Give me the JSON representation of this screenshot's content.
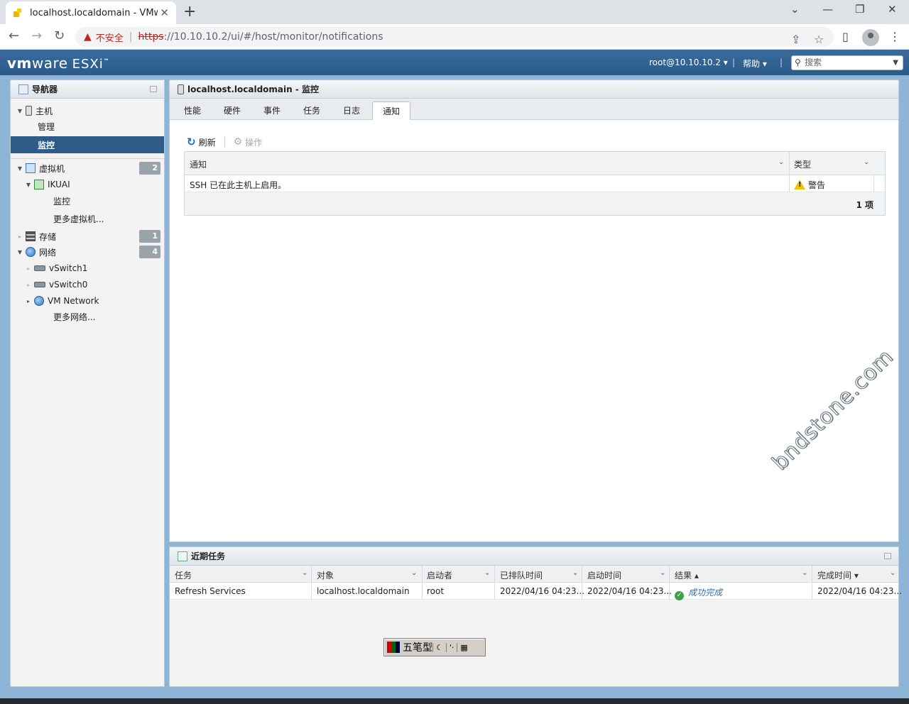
{
  "browser": {
    "tab_title": "localhost.localdomain - VMware ESXi",
    "new_tab": "+",
    "insecure_label": "不安全",
    "url_scheme": "https",
    "url_rest": "://10.10.10.2/ui/#/host/monitor/notifications"
  },
  "esxi_header": {
    "logo_vm": "vm",
    "logo_ware": "ware",
    "logo_product": "ESXi",
    "logo_tm": "™",
    "user": "root@10.10.10.2 ▾",
    "help": "帮助 ▾",
    "search_placeholder": "搜索"
  },
  "navigator": {
    "title": "导航器",
    "host_label": "主机",
    "host_manage": "管理",
    "host_monitor": "监控",
    "vms_label": "虚拟机",
    "vms_count": "2",
    "vm_name": "IKUAI",
    "vm_monitor": "监控",
    "vm_more": "更多虚拟机...",
    "storage_label": "存储",
    "storage_count": "1",
    "network_label": "网络",
    "network_count": "4",
    "net_vswitch1": "vSwitch1",
    "net_vswitch0": "vSwitch0",
    "net_vmnetwork": "VM Network",
    "net_more": "更多网络..."
  },
  "content": {
    "title": "localhost.localdomain - 监控",
    "tabs": [
      "性能",
      "硬件",
      "事件",
      "任务",
      "日志",
      "通知"
    ],
    "active_tab": "通知",
    "refresh_label": "刷新",
    "actions_label": "操作",
    "grid": {
      "columns": [
        "通知",
        "类型"
      ],
      "rows": [
        {
          "notification": "SSH 已在此主机上启用。",
          "type": "警告"
        }
      ],
      "footer": "1 项"
    }
  },
  "watermark": "bndstone.com",
  "recent_tasks": {
    "title": "近期任务",
    "columns": [
      "任务",
      "对象",
      "启动者",
      "已排队时间",
      "启动时间",
      "结果 ▴",
      "完成时间 ▾"
    ],
    "rows": [
      {
        "task": "Refresh Services",
        "target": "localhost.localdomain",
        "initiator": "root",
        "queued": "2022/04/16 04:23...",
        "started": "2022/04/16 04:23...",
        "result": "成功完成",
        "completed": "2022/04/16 04:23..."
      }
    ]
  },
  "ime": {
    "mode": "五笔型",
    "moon": "☾",
    "punct": "'·",
    "keyboard": "▦"
  }
}
